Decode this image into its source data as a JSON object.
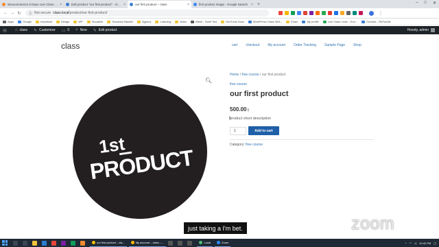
{
  "browser": {
    "tabs": [
      {
        "title": "Woocommerce 6 Days Live Class | ...",
        "color": "#f28b2f",
        "active": false
      },
      {
        "title": "Edit product \"our first product\" - cl...",
        "color": "#3c7fd1",
        "active": false
      },
      {
        "title": "our first product – class",
        "color": "#3c7fd1",
        "active": true
      },
      {
        "title": "first product image - Google Search",
        "color": "#4285f4",
        "active": false
      }
    ],
    "new_tab": "+",
    "address": {
      "security": "Not secure",
      "host": "class.local",
      "path": "/product/our-first-product/"
    },
    "bookmarks": [
      {
        "label": "Apps",
        "color": "#5f6368"
      },
      {
        "label": "Google",
        "color": "#4285f4"
      },
      {
        "label": "Important",
        "color": "#f2c33a"
      },
      {
        "label": "Design",
        "color": "#f2c33a"
      },
      {
        "label": "WP",
        "color": "#f2c33a"
      },
      {
        "label": "Scoobies",
        "color": "#f2c33a"
      },
      {
        "label": "Scoobidu Backlin",
        "color": "#f2c33a"
      },
      {
        "label": "Agency",
        "color": "#f2c33a"
      },
      {
        "label": "Learning",
        "color": "#f2c33a"
      },
      {
        "label": "Video",
        "color": "#f2c33a"
      },
      {
        "label": "Wekit - Tamil Tool",
        "color": "#555"
      },
      {
        "label": "DevTools Docs",
        "color": "#f2c33a"
      },
      {
        "label": "WordPress Class Writ...",
        "color": "#3c7fd1"
      },
      {
        "label": "Exam",
        "color": "#f2c33a"
      },
      {
        "label": "My profile",
        "color": "#3c7fd1"
      },
      {
        "label": "Live Class Links - Goo...",
        "color": "#2aa852"
      },
      {
        "label": "Contact – ReFundie",
        "color": "#3c7fd1"
      }
    ]
  },
  "wp_admin_bar": {
    "items": [
      "class",
      "Customize",
      "0",
      "New",
      "Edit product"
    ],
    "howdy": "Howdy, admin"
  },
  "site": {
    "title": "class",
    "nav": [
      "cart",
      "checkout",
      "My account",
      "Order Tracking",
      "Sample Page",
      "Shop"
    ]
  },
  "product": {
    "image_text_line1": "1st",
    "image_text_line2": "PRODUCT",
    "zoom_icon": "magnifier-icon",
    "breadcrumb": {
      "home": "Home",
      "sep": " / ",
      "category": "free course",
      "current": "our first product"
    },
    "category_top": "free course",
    "title": "our first product",
    "price": "500.00",
    "currency": "$",
    "short_description": "product short description",
    "quantity": "1",
    "add_to_cart": "Add to cart",
    "category_label": "Category:",
    "category_value": "free course"
  },
  "overlay": {
    "caption": "just taking a I'm bet.",
    "watermark": "zoom"
  },
  "taskbar": {
    "apps": [
      "our first product – cla...",
      "My account – class – ...",
      "Local",
      "Zoom"
    ],
    "clock": "10:42 PM"
  },
  "colors": {
    "link": "#2f72b3",
    "button": "#1e5fa8",
    "admin_bar": "#1d2327"
  }
}
